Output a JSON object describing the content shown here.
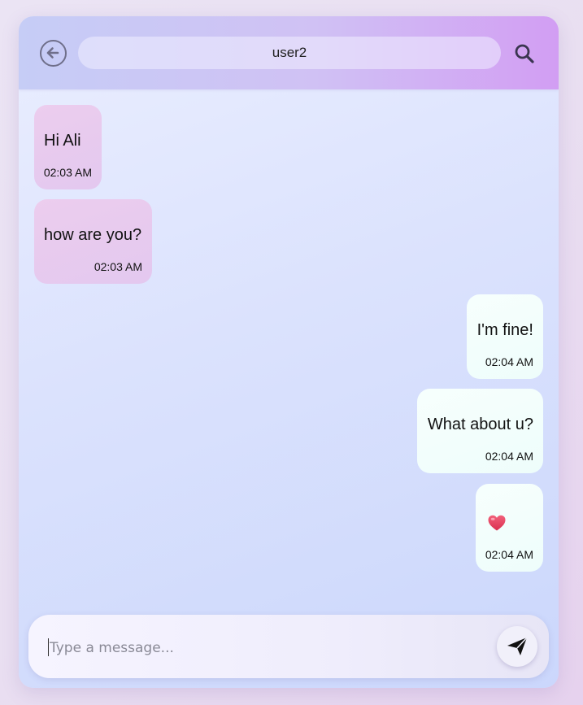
{
  "header": {
    "title": "user2",
    "back_icon": "arrow-left-circle-icon",
    "search_icon": "search-icon"
  },
  "messages": [
    {
      "direction": "incoming",
      "text": "Hi Ali",
      "time": "02:03 AM"
    },
    {
      "direction": "incoming",
      "text": "how are you?",
      "time": "02:03 AM"
    },
    {
      "direction": "outgoing",
      "text": "I'm fine!",
      "time": "02:04 AM"
    },
    {
      "direction": "outgoing",
      "text": "What about u?",
      "time": "02:04 AM"
    },
    {
      "direction": "outgoing",
      "text": "",
      "emoji": "heart-icon",
      "time": "02:04 AM"
    }
  ],
  "composer": {
    "placeholder": "Type a message...",
    "value": "",
    "send_icon": "send-icon"
  },
  "colors": {
    "incoming_bubble": "#e8cbef",
    "outgoing_bubble": "#f4fefc",
    "header_start": "#c6cdf6",
    "header_end": "#d29ef3",
    "heart": "#e8455f"
  }
}
